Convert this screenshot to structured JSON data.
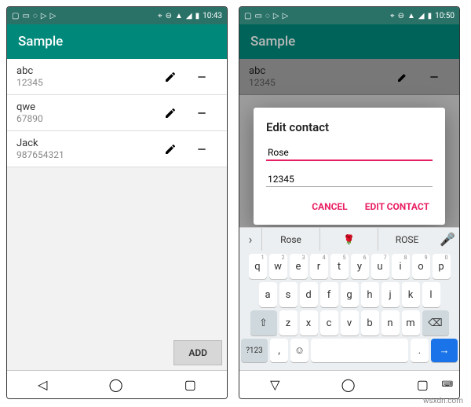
{
  "status": {
    "time_left": "10:43",
    "time_right": "10:50"
  },
  "app_title": "Sample",
  "contacts": [
    {
      "name": "abc",
      "phone": "12345"
    },
    {
      "name": "qwe",
      "phone": "67890"
    },
    {
      "name": "Jack",
      "phone": "987654321"
    }
  ],
  "add_button": "ADD",
  "dialog": {
    "title": "Edit contact",
    "name_value": "Rose",
    "phone_value": "12345",
    "cancel": "CANCEL",
    "confirm": "EDIT CONTACT"
  },
  "suggestions": {
    "a": "Rose",
    "b": "🌹",
    "c": "ROSE"
  },
  "keyboard": {
    "row1": [
      "q",
      "w",
      "e",
      "r",
      "t",
      "y",
      "u",
      "i",
      "o",
      "p"
    ],
    "row1_nums": [
      "1",
      "2",
      "3",
      "4",
      "5",
      "6",
      "7",
      "8",
      "9",
      "0"
    ],
    "row2": [
      "a",
      "s",
      "d",
      "f",
      "g",
      "h",
      "j",
      "k",
      "l"
    ],
    "row3": [
      "z",
      "x",
      "c",
      "v",
      "b",
      "n",
      "m"
    ],
    "sym": "?123",
    "period": "."
  },
  "watermark": "wsxdn.com"
}
